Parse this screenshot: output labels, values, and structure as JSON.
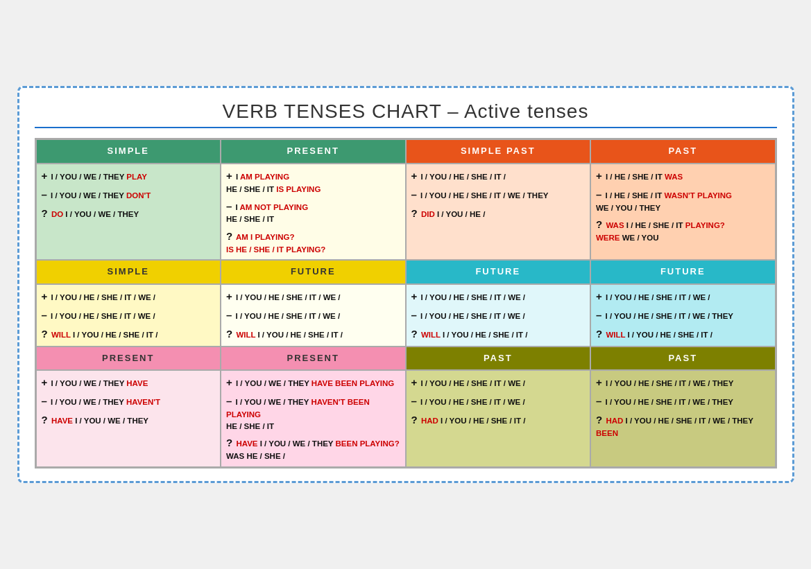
{
  "title": {
    "main": "VERB TENSES CHART",
    "sub": " – Active tenses"
  },
  "sections": {
    "row1_headers": [
      "SIMPLE",
      "PRESENT",
      "SIMPLE PAST",
      "PAST"
    ],
    "row2_headers": [
      "SIMPLE",
      "FUTURE",
      "FUTURE",
      "FUTURE"
    ],
    "row3_headers": [
      "PRESENT",
      "PRESENT",
      "PAST",
      "PAST"
    ]
  }
}
